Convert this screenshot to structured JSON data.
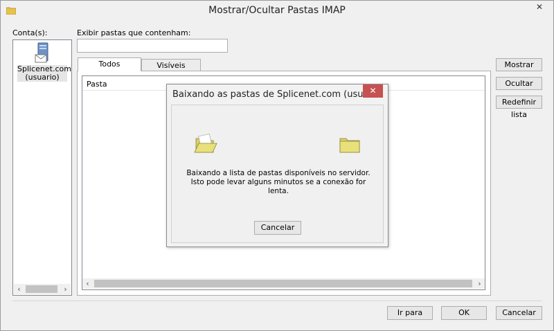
{
  "window": {
    "title": "Mostrar/Ocultar Pastas IMAP"
  },
  "accounts": {
    "label": "Conta(s):",
    "items": [
      {
        "name": "Splicenet.com",
        "sub": "(usuario)"
      }
    ]
  },
  "filter": {
    "label": "Exibir pastas que contenham:",
    "value": ""
  },
  "tabs": [
    {
      "label": "Todos",
      "active": true
    },
    {
      "label": "Visíveis",
      "active": false
    }
  ],
  "folder_list": {
    "column_header": "Pasta"
  },
  "side_buttons": {
    "show": "Mostrar",
    "hide": "Ocultar",
    "reset": "Redefinir lista"
  },
  "footer_buttons": {
    "goto": "Ir para",
    "ok": "OK",
    "cancel": "Cancelar"
  },
  "dialog": {
    "title": "Baixando as pastas de Splicenet.com (usuari...",
    "close_glyph": "✕",
    "message": "Baixando a lista de pastas disponíveis no servidor. Isto pode levar alguns minutos se a conexão for lenta.",
    "cancel": "Cancelar"
  },
  "icons": {
    "window_icon": "folder-icon",
    "account_icon": "server-mail-icon",
    "close": "close-icon"
  }
}
